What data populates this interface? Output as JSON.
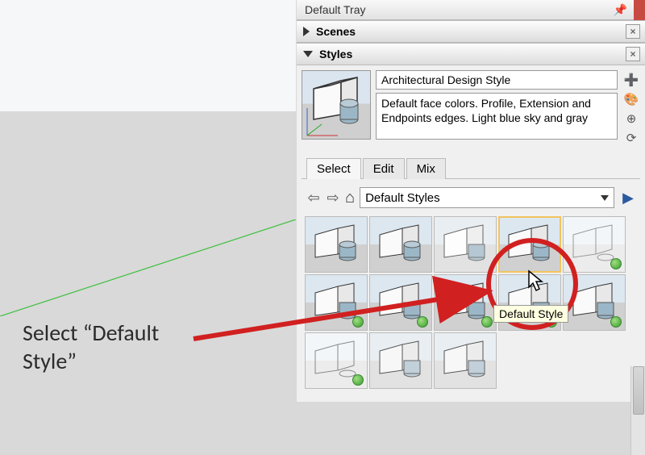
{
  "tray": {
    "title": "Default Tray",
    "sections": {
      "scenes": "Scenes",
      "styles": "Styles"
    }
  },
  "current_style": {
    "name": "Architectural Design Style",
    "description": "Default face colors. Profile, Extension and Endpoints edges. Light blue sky and gray"
  },
  "tabs": {
    "select": "Select",
    "edit": "Edit",
    "mix": "Mix"
  },
  "browser": {
    "library": "Default Styles"
  },
  "tooltip": "Default Style",
  "instruction_line1": "Select “Default",
  "instruction_line2": "Style”",
  "icons": {
    "pin": "📌",
    "close": "×",
    "plus": "➕",
    "paint": "🎨",
    "globe": "⊕",
    "refresh": "⟳",
    "back": "⇦",
    "fwd": "⇨",
    "home": "⌂",
    "details": "▶"
  }
}
